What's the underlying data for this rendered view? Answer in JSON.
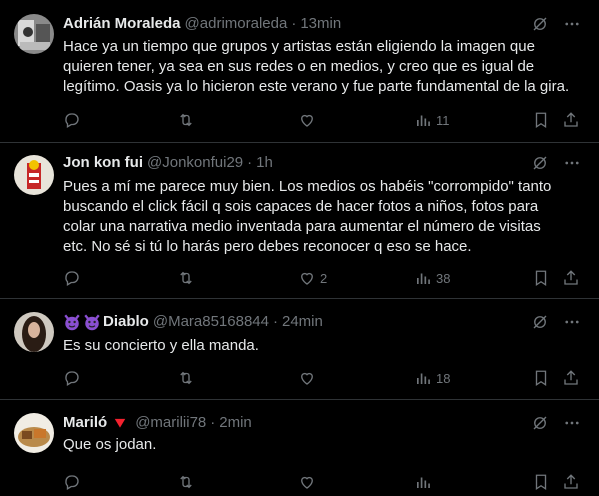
{
  "tweets": [
    {
      "name": "Adrián Moraleda",
      "handle": "@adrimoraleda",
      "sep": "·",
      "time": "13min",
      "lines": [
        "Hace ya un tiempo que grupos y artistas están eligiendo la imagen que",
        "quieren tener, ya sea en sus redes o en medios, y creo que es igual de",
        "legítimo. Oasis ya lo hicieron este verano y fue parte fundamental de la gira."
      ],
      "replies": "",
      "retweets": "",
      "likes": "",
      "views": "11"
    },
    {
      "name": "Jon kon fui",
      "handle": "@Jonkonfui29",
      "sep": "·",
      "time": "1h",
      "lines": [
        "Pues a mí me parece muy bien. Los medios os habéis \"corrompido\" tanto",
        "buscando el click fácil q sois capaces de hacer fotos a niños, fotos para",
        "colar una narrativa medio inventada para aumentar el número de visitas",
        "etc. No sé si tú lo harás pero debes reconocer q eso se hace."
      ],
      "replies": "",
      "retweets": "",
      "likes": "2",
      "views": "38"
    },
    {
      "name": "Diablo",
      "handle": "@Mara85168844",
      "sep": "·",
      "time": "24min",
      "lines": [
        "Es su concierto y ella manda."
      ],
      "replies": "",
      "retweets": "",
      "likes": "",
      "views": "18"
    },
    {
      "name": "Mariló",
      "handle": "@marilii78",
      "sep": "·",
      "time": "2min",
      "lines": [
        "Que os jodan."
      ],
      "replies": "",
      "retweets": "",
      "likes": "",
      "views": ""
    }
  ],
  "icons": {
    "reply": "reply-icon",
    "retweet": "retweet-icon",
    "like": "like-icon",
    "views": "views-icon",
    "bookmark": "bookmark-icon",
    "share": "share-icon",
    "grok": "grok-icon",
    "more": "more-icon"
  },
  "colors": {
    "background": "#000000",
    "text": "#e7e9ea",
    "muted": "#71767b",
    "divider": "#2f3336",
    "verified_badge": "#f4212e",
    "devil_emoji": "#8a4fd1"
  }
}
